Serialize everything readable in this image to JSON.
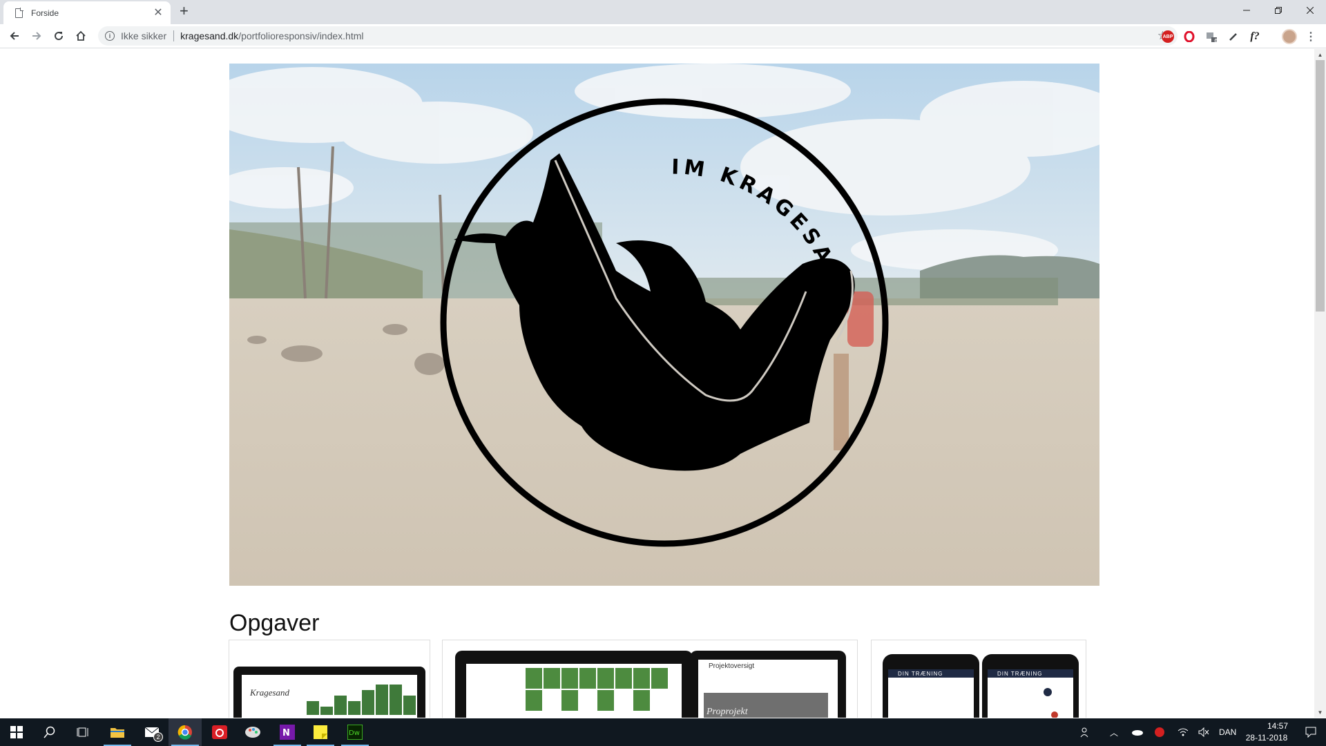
{
  "browser": {
    "tab_title": "Forside",
    "security_label": "Ikke sikker",
    "url_host": "kragesand.dk",
    "url_path": "/portfolioresponsiv/index.html",
    "extensions": [
      "ABP",
      "opera-icon",
      "0",
      "eyedropper-icon",
      "f?"
    ]
  },
  "page": {
    "logo_text": "IM KRAGESAND",
    "section_title": "Opgaver",
    "cards": [
      {
        "caption": "Kragesand"
      },
      {
        "caption": "Projektoversigt",
        "sub": "Proprojekt"
      },
      {
        "header": "DIN TRÆNING"
      }
    ]
  },
  "taskbar": {
    "language": "DAN",
    "time": "14:57",
    "date": "28-11-2018",
    "mail_badge": "2"
  },
  "colors": {
    "chrome_bg": "#dee1e6",
    "taskbar_bg": "#101820",
    "accent": "#76b9ed"
  }
}
